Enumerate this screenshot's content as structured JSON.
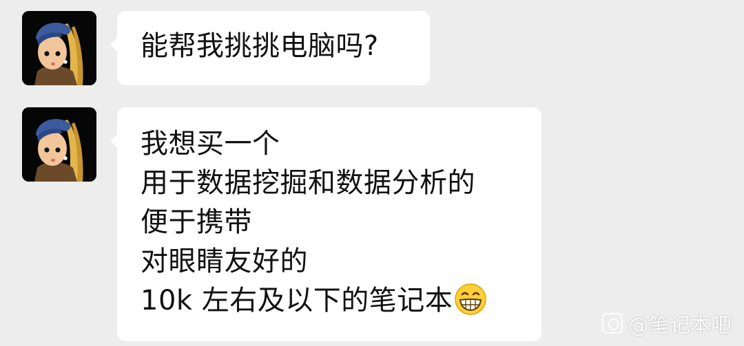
{
  "chat": {
    "messages": [
      {
        "avatar_icon": "girl-with-pearl-earring-avatar",
        "text": "能帮我挑挑电脑吗?"
      },
      {
        "avatar_icon": "girl-with-pearl-earring-avatar",
        "lines": [
          "我想买一个",
          "用于数据挖掘和数据分析的",
          "便于携带",
          "对眼睛友好的",
          "10k 左右及以下的笔记本"
        ],
        "trailing_emoji": "grinning-face-emoji"
      }
    ]
  },
  "watermark": {
    "text": "@笔记本吧",
    "icon": "tieba-paw-icon"
  },
  "colors": {
    "background": "#ededed",
    "bubble": "#ffffff",
    "text": "#111111"
  }
}
